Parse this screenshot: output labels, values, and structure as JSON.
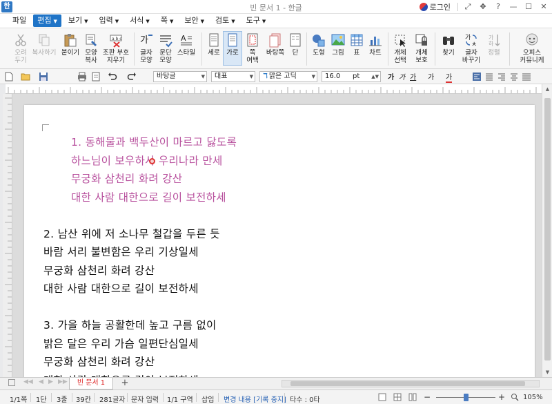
{
  "window": {
    "title": "빈 문서 1 - 한글",
    "login_label": "로그인",
    "app_icon_glyph": "한"
  },
  "menu": {
    "items": [
      {
        "label": "파일",
        "arrow": false,
        "active": false
      },
      {
        "label": "편집",
        "arrow": true,
        "active": true
      },
      {
        "label": "보기",
        "arrow": true,
        "active": false
      },
      {
        "label": "입력",
        "arrow": true,
        "active": false
      },
      {
        "label": "서식",
        "arrow": true,
        "active": false
      },
      {
        "label": "쪽",
        "arrow": true,
        "active": false
      },
      {
        "label": "보안",
        "arrow": true,
        "active": false
      },
      {
        "label": "검토",
        "arrow": true,
        "active": false
      },
      {
        "label": "도구",
        "arrow": true,
        "active": false
      }
    ]
  },
  "ribbon": {
    "cut": "오려\n두기",
    "copy": "복사하기",
    "paste": "붙이기",
    "format_copy": "모양\n복사",
    "jamo": "조판 부호\n지우기",
    "char_shape": "글자\n모양",
    "para_shape": "문단\n모양",
    "style": "스타일",
    "portrait": "세로",
    "landscape": "가로",
    "page_margin": "쪽\n여백",
    "background": "바탕쪽",
    "columns": "단",
    "shape": "도형",
    "picture": "그림",
    "table": "표",
    "chart": "차트",
    "select_obj": "개체\n선택",
    "protect_obj": "개체\n보호",
    "find": "찾기",
    "replace": "글자\n바꾸기",
    "align": "정렬",
    "office": "오피스\n커뮤니케"
  },
  "toolbar2": {
    "style_combo": "바탕글",
    "lang_combo": "대표",
    "font_combo": "맑은 고딕",
    "size_value": "16.0",
    "size_unit": "pt",
    "bold": "가",
    "italic": "가",
    "underline": "가",
    "strike": "가",
    "color_char": "가"
  },
  "document": {
    "verses": [
      {
        "color": "#b8519e",
        "indent": true,
        "lines": [
          "1. 동해물과 백두산이 마르고 닳도록",
          "하느님이 보우하사 우리나라 만세",
          "무궁화 삼천리 화려 강산",
          "대한 사람 대한으로 길이 보전하세"
        ]
      },
      {
        "color": "#111111",
        "indent": false,
        "lines": [
          "2. 남산 위에 저 소나무 철갑을 두른 듯",
          "바람 서리 불변함은 우리 기상일세",
          "무궁화 삼천리 화려 강산",
          "대한 사람 대한으로 길이 보전하세"
        ]
      },
      {
        "color": "#111111",
        "indent": false,
        "lines": [
          "3. 가을 하늘 공활한데 높고 구름 없이",
          "밝은 달은 우리 가슴 일편단심일세",
          "무궁화 삼천리 화려 강산",
          "대한 사람 대한으로 길이 보전하세"
        ]
      }
    ]
  },
  "tabs": {
    "doc_tab": "빈 문서 1",
    "add_tab": "+"
  },
  "status": {
    "page": "1/1쪽",
    "column": "1단",
    "line": "3줄",
    "col": "39칸",
    "chars": "281글자",
    "mode": "문자 입력",
    "section": "1/1 구역",
    "insert": "삽입",
    "track": "변경 내용 [기록 중지]",
    "typing": "타수 : 0타",
    "zoom": "105%"
  },
  "colors": {
    "accent": "#1f74c7",
    "verse1": "#b8519e"
  }
}
